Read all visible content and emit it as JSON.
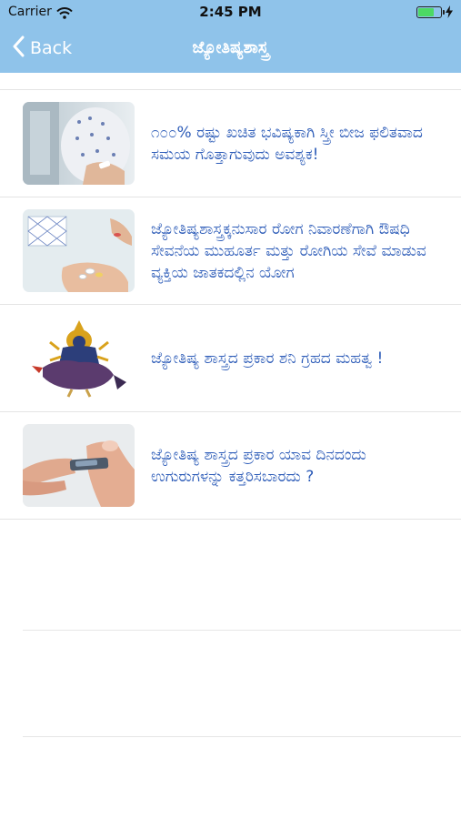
{
  "status_bar": {
    "carrier": "Carrier",
    "time": "2:45 PM",
    "battery_level": 0.75
  },
  "nav": {
    "back_label": "Back",
    "title": "ಜ್ಯೋತಿಷ್ಯಶಾಸ್ತ್ರ"
  },
  "articles": [
    {
      "title": "೧೦೦% ರಷ್ಟು ಖಚಿತ ಭವಿಷ್ಯಕಾಗಿ ಸ್ತ್ರೀ ಬೀಜ ಫಲಿತವಾದ ಸಮಯ ಗೊತ್ತಾಗುವುದು ಅವಶ್ಯಕ!",
      "thumb_icon": "pregnant-woman-photo"
    },
    {
      "title": "ಜ್ಯೋತಿಷ್ಯಶಾಸ್ತ್ರಕ್ಕನುಸಾರ ರೋಗ ನಿವಾರಣೆಗಾಗಿ ಔಷಧಿ ಸೇವನೆಯ ಮುಹೂರ್ತ ಮತ್ತು ರೋಗಿಯ ಸೇವೆ ಮಾಡುವ ವ್ಯಕ್ತಿಯ ಜಾತಕದಲ್ಲಿನ ಯೋಗ",
      "thumb_icon": "medicine-pills-photo"
    },
    {
      "title": "ಜ್ಯೋತಿಷ್ಯ ಶಾಸ್ತ್ರದ ಪ್ರಕಾರ ಶನಿ ಗ್ರಹದ ಮಹತ್ವ !",
      "thumb_icon": "shani-deity-image"
    },
    {
      "title": "ಜ್ಯೋತಿಷ್ಯ ಶಾಸ್ತ್ರದ ಪ್ರಕಾರ ಯಾವ ದಿನದಂದು ಉಗುರುಗಳನ್ನು ಕತ್ತರಿಸಬಾರದು ?",
      "thumb_icon": "nail-clipper-photo"
    }
  ],
  "colors": {
    "nav_bar": "#8fc3ea",
    "article_text": "#2d5cb8",
    "separator": "#e4e4e4"
  }
}
